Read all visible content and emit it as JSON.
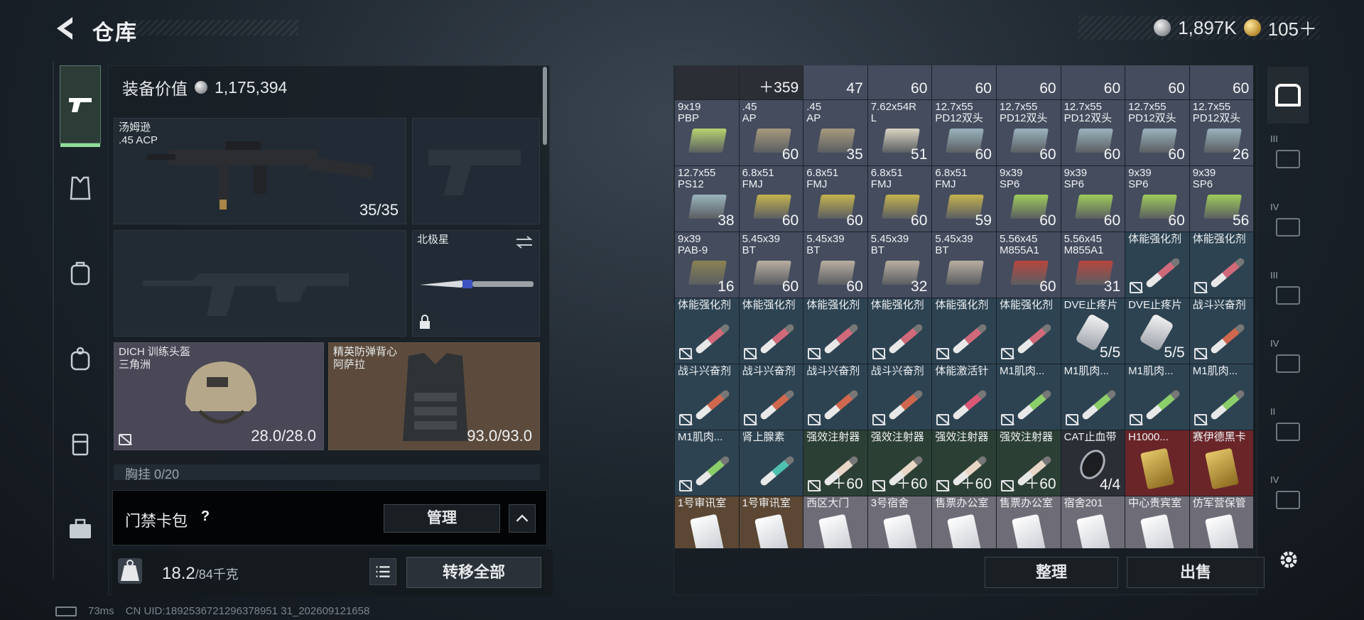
{
  "header": {
    "title": "仓库",
    "currency_silver": "1,897K",
    "currency_gold": "105＋"
  },
  "equipment": {
    "value_label": "装备价值",
    "value": "1,175,394",
    "primary_weapon": {
      "name": "汤姆逊",
      "ammo_type": ".45 ACP",
      "ammo": "35/35"
    },
    "melee": {
      "name": "北极星"
    },
    "helmet": {
      "name": "DICH 训练头盔",
      "map": "三角洲",
      "durability": "28.0/28.0"
    },
    "vest": {
      "name": "精英防弹背心",
      "map": "阿萨拉",
      "durability": "93.0/93.0"
    },
    "chest_rig": "胸挂 0/20"
  },
  "keycard": {
    "label": "门禁卡包",
    "help": "?",
    "manage": "管理"
  },
  "weight": {
    "current": "18.2",
    "max": "/84千克"
  },
  "actions": {
    "transfer_all": "转移全部",
    "sort": "整理",
    "sell": "出售"
  },
  "icons": {
    "back": "back-arrow-icon",
    "settings": "gear-icon",
    "rail": [
      "pistol-icon",
      "armor-vest-icon",
      "backpack-icon",
      "bag-icon",
      "container-icon",
      "toolbox-icon"
    ]
  },
  "grid": [
    {
      "name": "",
      "qty": "",
      "kind": "dark"
    },
    {
      "name": "",
      "qty": "＋359",
      "kind": "dark"
    },
    {
      "name": "",
      "qty": "47",
      "kind": "ammo"
    },
    {
      "name": "",
      "qty": "60",
      "kind": "ammo"
    },
    {
      "name": "",
      "qty": "60",
      "kind": "ammo"
    },
    {
      "name": "",
      "qty": "60",
      "kind": "ammo"
    },
    {
      "name": "",
      "qty": "60",
      "kind": "ammo"
    },
    {
      "name": "",
      "qty": "60",
      "kind": "ammo"
    },
    {
      "name": "",
      "qty": "60",
      "kind": "ammo"
    },
    {
      "name": "9x19\nPBP",
      "qty": "",
      "kind": "ammo",
      "color": "#b7d36e"
    },
    {
      "name": ".45\nAP",
      "qty": "60",
      "kind": "ammo",
      "color": "#a79a7e"
    },
    {
      "name": ".45\nAP",
      "qty": "35",
      "kind": "ammo",
      "color": "#a79a7e"
    },
    {
      "name": "7.62x54R\nL",
      "qty": "51",
      "kind": "ammo",
      "color": "#d9d4c2"
    },
    {
      "name": "12.7x55\nPD12双头",
      "qty": "60",
      "kind": "ammo",
      "color": "#9ab3bd"
    },
    {
      "name": "12.7x55\nPD12双头",
      "qty": "60",
      "kind": "ammo",
      "color": "#9ab3bd"
    },
    {
      "name": "12.7x55\nPD12双头",
      "qty": "60",
      "kind": "ammo",
      "color": "#9ab3bd"
    },
    {
      "name": "12.7x55\nPD12双头",
      "qty": "60",
      "kind": "ammo",
      "color": "#9ab3bd"
    },
    {
      "name": "12.7x55\nPD12双头",
      "qty": "26",
      "kind": "ammo",
      "color": "#9ab3bd"
    },
    {
      "name": "12.7x55\nPS12",
      "qty": "38",
      "kind": "ammo",
      "color": "#9ab3bd"
    },
    {
      "name": "6.8x51\nFMJ",
      "qty": "60",
      "kind": "ammo",
      "color": "#c4b24e"
    },
    {
      "name": "6.8x51\nFMJ",
      "qty": "60",
      "kind": "ammo",
      "color": "#c4b24e"
    },
    {
      "name": "6.8x51\nFMJ",
      "qty": "60",
      "kind": "ammo",
      "color": "#c4b24e"
    },
    {
      "name": "6.8x51\nFMJ",
      "qty": "59",
      "kind": "ammo",
      "color": "#c4b24e"
    },
    {
      "name": "9x39\nSP6",
      "qty": "60",
      "kind": "ammo",
      "color": "#9fcc5a"
    },
    {
      "name": "9x39\nSP6",
      "qty": "60",
      "kind": "ammo",
      "color": "#9fcc5a"
    },
    {
      "name": "9x39\nSP6",
      "qty": "60",
      "kind": "ammo",
      "color": "#9fcc5a"
    },
    {
      "name": "9x39\nSP6",
      "qty": "56",
      "kind": "ammo",
      "color": "#9fcc5a"
    },
    {
      "name": "9x39\nPAB-9",
      "qty": "16",
      "kind": "ammo",
      "color": "#8a8252"
    },
    {
      "name": "5.45x39\nBT",
      "qty": "60",
      "kind": "ammo",
      "color": "#b8aea0"
    },
    {
      "name": "5.45x39\nBT",
      "qty": "60",
      "kind": "ammo",
      "color": "#b8aea0"
    },
    {
      "name": "5.45x39\nBT",
      "qty": "32",
      "kind": "ammo",
      "color": "#b8aea0"
    },
    {
      "name": "5.45x39\nBT",
      "qty": "",
      "kind": "ammo",
      "color": "#b8aea0"
    },
    {
      "name": "5.56x45\nM855A1",
      "qty": "60",
      "kind": "ammo",
      "color": "#b8463e"
    },
    {
      "name": "5.56x45\nM855A1",
      "qty": "31",
      "kind": "ammo",
      "color": "#b8463e"
    },
    {
      "name": "体能强化剂",
      "qty": "",
      "kind": "med-blue",
      "color": "#d06a7a",
      "locked": true
    },
    {
      "name": "体能强化剂",
      "qty": "",
      "kind": "med-blue",
      "color": "#d06a7a",
      "locked": true
    },
    {
      "name": "体能强化剂",
      "qty": "",
      "kind": "med-blue",
      "color": "#d06a7a",
      "locked": true
    },
    {
      "name": "体能强化剂",
      "qty": "",
      "kind": "med-blue",
      "color": "#d06a7a",
      "locked": true
    },
    {
      "name": "体能强化剂",
      "qty": "",
      "kind": "med-blue",
      "color": "#d06a7a",
      "locked": true
    },
    {
      "name": "体能强化剂",
      "qty": "",
      "kind": "med-blue",
      "color": "#d06a7a",
      "locked": true
    },
    {
      "name": "体能强化剂",
      "qty": "",
      "kind": "med-blue",
      "color": "#d06a7a",
      "locked": true
    },
    {
      "name": "体能强化剂",
      "qty": "",
      "kind": "med-blue",
      "color": "#d06a7a",
      "locked": true
    },
    {
      "name": "DVE止疼片",
      "qty": "5/5",
      "kind": "med-blue",
      "color": "pill"
    },
    {
      "name": "DVE止疼片",
      "qty": "5/5",
      "kind": "med-blue",
      "color": "pill"
    },
    {
      "name": "战斗兴奋剂",
      "qty": "",
      "kind": "med-blue",
      "color": "#d0684e",
      "locked": true
    },
    {
      "name": "战斗兴奋剂",
      "qty": "",
      "kind": "med-blue",
      "color": "#d0684e",
      "locked": true
    },
    {
      "name": "战斗兴奋剂",
      "qty": "",
      "kind": "med-blue",
      "color": "#d0684e",
      "locked": true
    },
    {
      "name": "战斗兴奋剂",
      "qty": "",
      "kind": "med-blue",
      "color": "#d0684e",
      "locked": true
    },
    {
      "name": "战斗兴奋剂",
      "qty": "",
      "kind": "med-blue",
      "color": "#d0684e",
      "locked": true
    },
    {
      "name": "体能激活针",
      "qty": "",
      "kind": "med-blue",
      "color": "#d85876",
      "locked": true
    },
    {
      "name": "M1肌肉...",
      "qty": "",
      "kind": "med-blue",
      "color": "#8ccf6a",
      "locked": true
    },
    {
      "name": "M1肌肉...",
      "qty": "",
      "kind": "med-blue",
      "color": "#8ccf6a",
      "locked": true
    },
    {
      "name": "M1肌肉...",
      "qty": "",
      "kind": "med-blue",
      "color": "#8ccf6a",
      "locked": true
    },
    {
      "name": "M1肌肉...",
      "qty": "",
      "kind": "med-blue",
      "color": "#8ccf6a",
      "locked": true
    },
    {
      "name": "M1肌肉...",
      "qty": "",
      "kind": "med-blue",
      "color": "#8ccf6a",
      "locked": true
    },
    {
      "name": "肾上腺素",
      "qty": "",
      "kind": "med-blue",
      "color": "#4fc1b0"
    },
    {
      "name": "强效注射器",
      "qty": "＋60",
      "kind": "med-green",
      "color": "#e8d6c6",
      "locked": true
    },
    {
      "name": "强效注射器",
      "qty": "＋60",
      "kind": "med-green",
      "color": "#e8d6c6",
      "locked": true
    },
    {
      "name": "强效注射器",
      "qty": "＋60",
      "kind": "med-green",
      "color": "#e8d6c6",
      "locked": true
    },
    {
      "name": "强效注射器",
      "qty": "＋60",
      "kind": "med-green",
      "color": "#e8d6c6",
      "locked": true
    },
    {
      "name": "CAT止血带",
      "qty": "4/4",
      "kind": "dark",
      "color": "tourniquet"
    },
    {
      "name": "H1000...",
      "qty": "",
      "kind": "red",
      "color": "gold-card"
    },
    {
      "name": "赛伊德黑卡",
      "qty": "",
      "kind": "red",
      "color": "gold-card"
    },
    {
      "name": "1号审讯室",
      "qty": "",
      "kind": "key brown",
      "color": "keycard"
    },
    {
      "name": "1号审讯室",
      "qty": "",
      "kind": "key brown",
      "color": "keycard"
    },
    {
      "name": "西区大门",
      "qty": "",
      "kind": "key",
      "color": "keycard"
    },
    {
      "name": "3号宿舍",
      "qty": "",
      "kind": "key",
      "color": "keycard"
    },
    {
      "name": "售票办公室",
      "qty": "",
      "kind": "key",
      "color": "keycard"
    },
    {
      "name": "售票办公室",
      "qty": "",
      "kind": "key",
      "color": "keycard"
    },
    {
      "name": "宿舍201",
      "qty": "",
      "kind": "key",
      "color": "keycard"
    },
    {
      "name": "中心贵宾室",
      "qty": "",
      "kind": "key",
      "color": "keycard"
    },
    {
      "name": "仿军营保管",
      "qty": "",
      "kind": "key",
      "color": "keycard"
    }
  ],
  "right_rail": {
    "tiers": [
      "",
      "III",
      "IV",
      "III",
      "IV",
      "II",
      "IV"
    ]
  },
  "status": {
    "ping": "73ms",
    "uid": "CN UID:1892536721296378951 31_202609121658"
  }
}
